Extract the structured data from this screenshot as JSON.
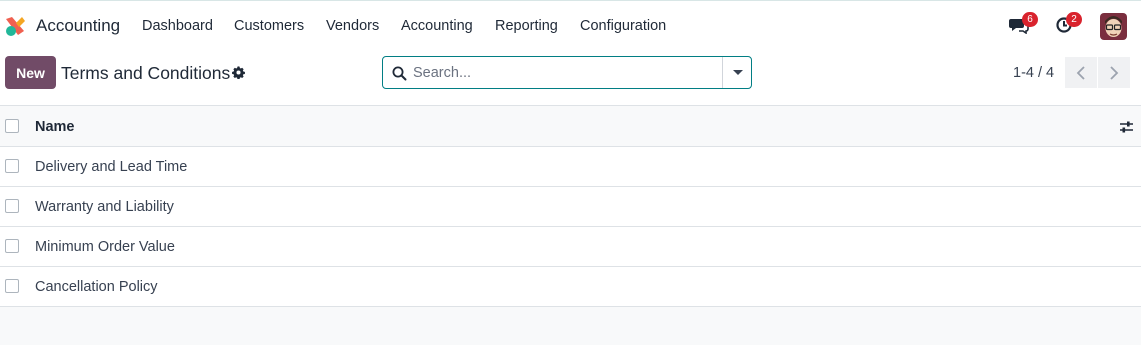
{
  "app": {
    "name": "Accounting"
  },
  "menu": [
    "Dashboard",
    "Customers",
    "Vendors",
    "Accounting",
    "Reporting",
    "Configuration"
  ],
  "systray": {
    "messages_count": "6",
    "activities_count": "2"
  },
  "control_panel": {
    "new_label": "New",
    "title": "Terms and Conditions",
    "search_placeholder": "Search...",
    "pager": "1-4 / 4"
  },
  "list": {
    "column_name": "Name",
    "rows": [
      "Delivery and Lead Time",
      "Warranty and Liability",
      "Minimum Order Value",
      "Cancellation Policy"
    ]
  },
  "colors": {
    "brand": "#714b67",
    "accent": "#017e84",
    "badge": "#d9232d"
  },
  "icons": [
    "app-logo-icon",
    "chat-icon",
    "clock-icon",
    "gear-icon",
    "search-icon",
    "caret-down-icon",
    "chevron-left-icon",
    "chevron-right-icon",
    "sliders-icon"
  ]
}
